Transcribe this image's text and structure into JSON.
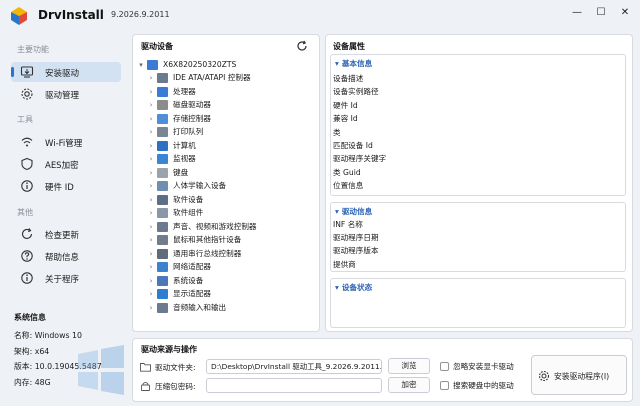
{
  "window": {
    "title": "DrvInstall",
    "version": "9.2026.9.2011",
    "minimize_glyph": "—",
    "maximize_glyph": "☐",
    "close_glyph": "✕"
  },
  "sidebar": {
    "section_main": "主要功能",
    "items_main": [
      {
        "label": "安装驱动",
        "icon": "install-driver-icon"
      },
      {
        "label": "驱动管理",
        "icon": "gear-icon"
      }
    ],
    "section_tools": "工具",
    "items_tools": [
      {
        "label": "Wi-Fi管理",
        "icon": "wifi-icon"
      },
      {
        "label": "AES加密",
        "icon": "shield-icon"
      },
      {
        "label": "硬件 ID",
        "icon": "info-icon"
      }
    ],
    "section_other": "其他",
    "items_other": [
      {
        "label": "检查更新",
        "icon": "refresh-icon"
      },
      {
        "label": "帮助信息",
        "icon": "help-icon"
      },
      {
        "label": "关于程序",
        "icon": "info-icon"
      }
    ]
  },
  "system_info": {
    "title": "系统信息",
    "name": "名称: Windows 10",
    "arch": "架构: x64",
    "version": "版本: 10.0.19045.5487",
    "memory": "内存: 48G"
  },
  "devices": {
    "title": "驱动设备",
    "root": "X6X820250320ZTS",
    "items": [
      "IDE ATA/ATAPI 控制器",
      "处理器",
      "磁盘驱动器",
      "存储控制器",
      "打印队列",
      "计算机",
      "监视器",
      "键盘",
      "人体学输入设备",
      "软件设备",
      "软件组件",
      "声音、视频和游戏控制器",
      "鼠标和其他指针设备",
      "通用串行总线控制器",
      "网络适配器",
      "系统设备",
      "显示适配器",
      "音频输入和输出"
    ]
  },
  "properties": {
    "title": "设备属性",
    "basic": {
      "header": "基本信息",
      "lines": [
        "设备描述",
        "设备实例路径",
        "硬件 Id",
        "兼容 Id",
        "类",
        "匹配设备 Id",
        "驱动程序关键字",
        "类 Guid",
        "位置信息"
      ]
    },
    "driver": {
      "header": "驱动信息",
      "lines": [
        "INF 名称",
        "驱动程序日期",
        "驱动程序版本",
        "提供商"
      ]
    },
    "status": {
      "header": "设备状态"
    }
  },
  "source": {
    "title": "驱动来源与操作",
    "folder_label": "驱动文件夹:",
    "folder_value": "D:\\Desktop\\DrvInstall 驱动工具_9.2026.9.2011...",
    "browse_label": "浏览",
    "password_label": "压缩包密码:",
    "password_value": "",
    "decrypt_label": "加密",
    "ignore_gpu_label": "忽略安装显卡驱动",
    "search_disk_label": "搜索硬盘中的驱动",
    "install_label": "安装驱动程序(I)"
  },
  "colors": {
    "accent": "#2a73c7",
    "selected_bg": "#d3e2f3",
    "group_header": "#2a62b5"
  }
}
